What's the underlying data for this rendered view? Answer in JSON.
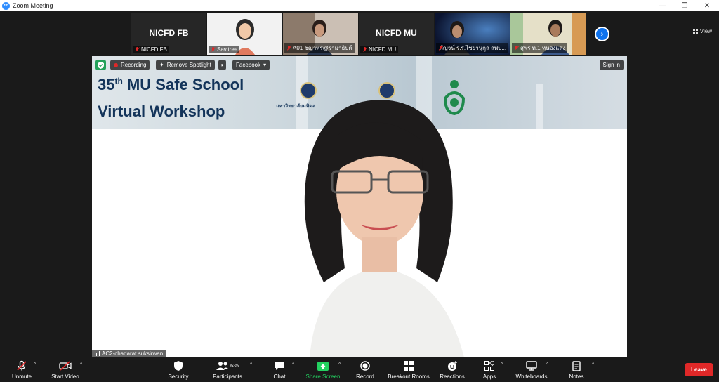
{
  "window": {
    "title": "Zoom Meeting",
    "logo_text": "zm"
  },
  "view_label": "View",
  "strip": [
    {
      "big_name": "NICFD FB",
      "label": "NICFD FB",
      "type": "text"
    },
    {
      "big_name": "",
      "label": "Savitree",
      "type": "avatar"
    },
    {
      "big_name": "",
      "label": "A01 ชญาพร@รามาธิบดี",
      "type": "video"
    },
    {
      "big_name": "NICFD MU",
      "label": "NICFD MU",
      "type": "text"
    },
    {
      "big_name": "",
      "label": "กัญจน์ ร.ร.ไชยานุกูล สพป...",
      "type": "video"
    },
    {
      "big_name": "",
      "label": "สุพร ท.1 หนองแสง",
      "type": "video"
    }
  ],
  "meeting_bar": {
    "recording": "Recording",
    "spotlight": "Remove Spotlight",
    "facebook": "Facebook",
    "signin": "Sign in"
  },
  "banner": {
    "ordinal_num": "35",
    "ordinal_sup": "th",
    "line1": "MU Safe School",
    "line2": "Virtual Workshop",
    "uni_text": "มหาวิทยาลัยมหิดล"
  },
  "speaker_name": "AC2-chadarat suksirwan",
  "toolbar": {
    "unmute": "Unmute",
    "start_video": "Start Video",
    "security": "Security",
    "participants": "Participants",
    "participants_count": "635",
    "chat": "Chat",
    "share_screen": "Share Screen",
    "record": "Record",
    "breakout": "Breakout Rooms",
    "reactions": "Reactions",
    "apps": "Apps",
    "whiteboards": "Whiteboards",
    "notes": "Notes",
    "leave": "Leave"
  },
  "colors": {
    "accent": "#0e72ed",
    "leave": "#e02828",
    "share": "#23d160"
  }
}
